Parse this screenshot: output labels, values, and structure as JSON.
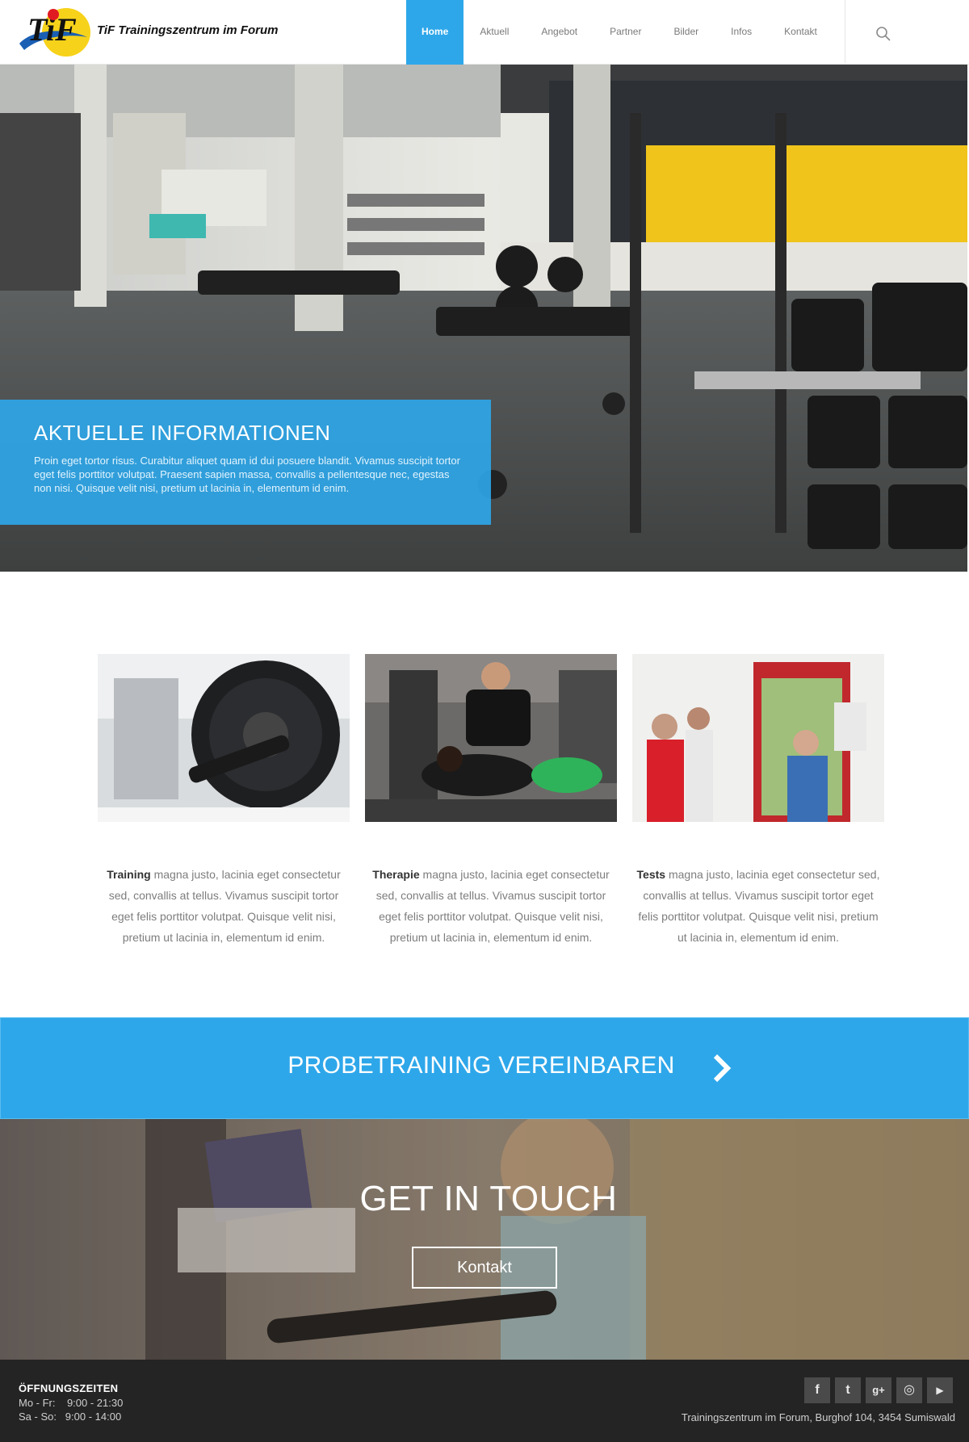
{
  "header": {
    "brand": "TiF Trainingszentrum im Forum",
    "nav": [
      "Home",
      "Aktuell",
      "Angebot",
      "Partner",
      "Bilder",
      "Infos",
      "Kontakt"
    ],
    "active_nav": "Home"
  },
  "hero": {
    "title": "AKTUELLE INFORMATIONEN",
    "text": "Proin eget tortor risus. Curabitur aliquet quam id dui posuere blandit. Vivamus suscipit tortor eget felis porttitor volutpat. Praesent sapien massa, convallis a pellentesque nec, egestas non nisi. Quisque velit nisi, pretium ut lacinia in, elementum id enim."
  },
  "features": [
    {
      "bold": "Training",
      "text": " magna justo, lacinia eget consectetur sed, convallis at tellus. Vivamus suscipit tortor eget felis porttitor volutpat. Quisque velit nisi, pretium ut lacinia in, elementum id enim."
    },
    {
      "bold": "Therapie",
      "text": " magna justo, lacinia eget consectetur sed, convallis at tellus. Vivamus suscipit tortor eget felis porttitor volutpat. Quisque velit nisi, pretium ut lacinia in, elementum id enim."
    },
    {
      "bold": "Tests",
      "text": " magna justo, lacinia eget consectetur sed, convallis at tellus. Vivamus suscipit tortor eget felis porttitor volutpat.  Quisque velit nisi, pretium ut lacinia in, elementum id enim."
    }
  ],
  "cta": {
    "label": "PROBETRAINING VEREINBAREN"
  },
  "touch": {
    "title": "GET IN TOUCH",
    "button": "Kontakt"
  },
  "footer": {
    "hours_title": "ÖFFNUNGSZEITEN",
    "hours": [
      "Mo - Fr:    9:00 - 21:30",
      "Sa - So:   9:00 - 14:00"
    ],
    "address": "Trainingszentrum im Forum, Burghof 104, 3454 Sumiswald",
    "socials": [
      {
        "name": "facebook",
        "glyph": "f"
      },
      {
        "name": "twitter",
        "glyph": "t"
      },
      {
        "name": "google-plus",
        "glyph": "g+"
      },
      {
        "name": "instagram",
        "glyph": "◎"
      },
      {
        "name": "youtube",
        "glyph": "▶"
      }
    ]
  },
  "colors": {
    "accent": "#2ea7ea",
    "footer": "#242424",
    "text": "#7d7d7d"
  }
}
